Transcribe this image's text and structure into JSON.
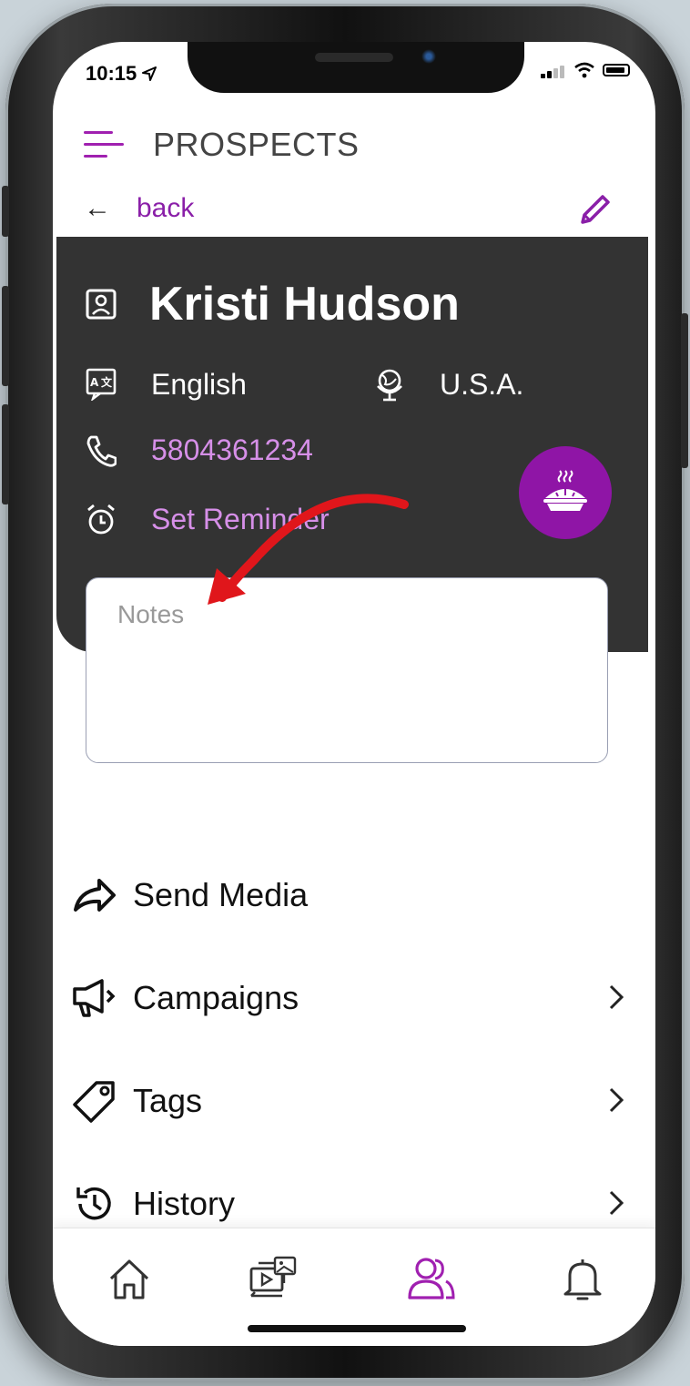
{
  "status": {
    "time": "10:15"
  },
  "header": {
    "title": "PROSPECTS",
    "back_label": "back"
  },
  "contact": {
    "name": "Kristi Hudson",
    "language": "English",
    "country": "U.S.A.",
    "phone": "5804361234",
    "reminder_label": "Set Reminder"
  },
  "notes": {
    "placeholder": "Notes"
  },
  "menu": [
    {
      "label": "Send Media",
      "icon": "share-arrow-icon"
    },
    {
      "label": "Campaigns",
      "icon": "megaphone-icon"
    },
    {
      "label": "Tags",
      "icon": "tag-icon"
    },
    {
      "label": "History",
      "icon": "history-icon"
    }
  ],
  "tabs": [
    {
      "name": "home",
      "icon": "home-icon"
    },
    {
      "name": "media",
      "icon": "media-library-icon"
    },
    {
      "name": "prospects",
      "icon": "people-icon",
      "active": true
    },
    {
      "name": "notifications",
      "icon": "bell-icon"
    }
  ],
  "colors": {
    "accent": "#8a1fa8",
    "card": "#333333",
    "link": "#d68fe8",
    "annotation": "#e0161b"
  }
}
